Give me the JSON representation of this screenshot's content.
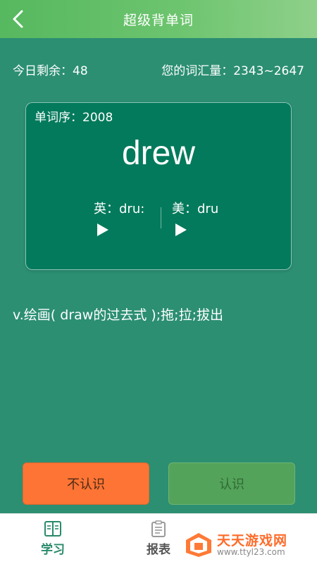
{
  "header": {
    "title": "超级背单词"
  },
  "stats": {
    "remaining": "今日剩余：48",
    "vocab": "您的词汇量：2343~2647"
  },
  "card": {
    "seq": "单词序：2008",
    "word": "drew",
    "uk": "英：dru:",
    "us": "美：dru"
  },
  "meaning": "v.绘画( draw的过去式 );拖;拉;拔出",
  "buttons": {
    "unknown": "不认识",
    "known": "认识"
  },
  "nav": [
    {
      "label": "学习",
      "icon": "book-icon"
    },
    {
      "label": "报表",
      "icon": "clipboard-icon"
    }
  ],
  "watermark": {
    "name": "天天游戏网",
    "url": "www.ttyl23.com"
  },
  "colors": {
    "background": "#2c8f72",
    "header": "#6cc46e",
    "card": "#037a5c",
    "unknown_button": "#fd7434",
    "known_button": "#54a35a",
    "nav_active": "#2a8a6c"
  }
}
